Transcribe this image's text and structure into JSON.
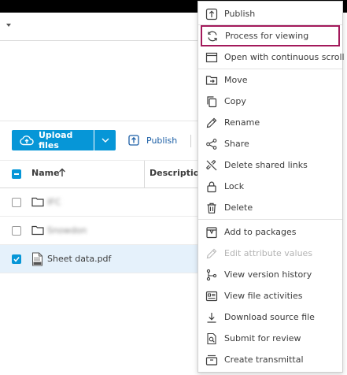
{
  "toolbar": {
    "upload_label": "Upload files",
    "publish_label": "Publish"
  },
  "table": {
    "headers": {
      "name": "Name",
      "description": "Description"
    },
    "rows": [
      {
        "name": "IFC",
        "selected": false,
        "type": "folder"
      },
      {
        "name": "Snowdon",
        "selected": false,
        "type": "folder"
      },
      {
        "name": "Sheet data.pdf",
        "selected": true,
        "type": "pdf"
      }
    ]
  },
  "context_menu": {
    "highlighted": "Process for viewing",
    "items": [
      {
        "label": "Publish",
        "icon": "publish-icon"
      },
      {
        "label": "Process for viewing",
        "icon": "refresh-icon"
      },
      {
        "label": "Open with continuous scroll",
        "icon": "window-icon"
      },
      {
        "label": "Move",
        "icon": "move-icon"
      },
      {
        "label": "Copy",
        "icon": "copy-icon"
      },
      {
        "label": "Rename",
        "icon": "pencil-icon"
      },
      {
        "label": "Share",
        "icon": "share-icon"
      },
      {
        "label": "Delete shared links",
        "icon": "unlink-icon"
      },
      {
        "label": "Lock",
        "icon": "lock-icon"
      },
      {
        "label": "Delete",
        "icon": "trash-icon"
      },
      {
        "label": "Add to packages",
        "icon": "package-icon"
      },
      {
        "label": "Edit attribute values",
        "icon": "pencil-icon",
        "disabled": true
      },
      {
        "label": "View version history",
        "icon": "version-history-icon"
      },
      {
        "label": "View file activities",
        "icon": "activity-icon"
      },
      {
        "label": "Download source file",
        "icon": "download-icon"
      },
      {
        "label": "Submit for review",
        "icon": "review-icon"
      },
      {
        "label": "Create transmittal",
        "icon": "transmittal-icon"
      }
    ]
  },
  "colors": {
    "accent": "#0696d7",
    "highlight_border": "#a3195b",
    "selected_row": "#e5f1fb"
  }
}
